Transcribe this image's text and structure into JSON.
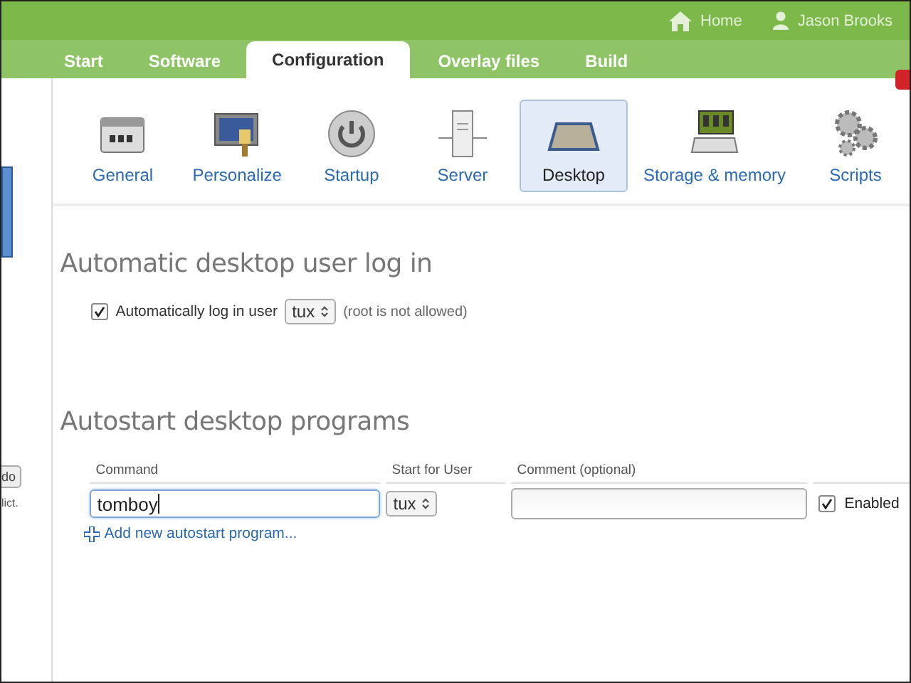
{
  "header": {
    "links": [
      {
        "label": "Home",
        "kind": "home"
      },
      {
        "label": "Jason Brooks",
        "kind": "user"
      }
    ]
  },
  "tabs": [
    {
      "label": "Start",
      "selected": false
    },
    {
      "label": "Software",
      "selected": false
    },
    {
      "label": "Configuration",
      "selected": true
    },
    {
      "label": "Overlay files",
      "selected": false
    },
    {
      "label": "Build",
      "selected": false
    }
  ],
  "categories": [
    {
      "label": "General",
      "kind": "general",
      "selected": false
    },
    {
      "label": "Personalize",
      "kind": "personalize",
      "selected": false
    },
    {
      "label": "Startup",
      "kind": "startup",
      "selected": false
    },
    {
      "label": "Server",
      "kind": "server",
      "selected": false
    },
    {
      "label": "Desktop",
      "kind": "desktop",
      "selected": true
    },
    {
      "label": "Storage & memory",
      "kind": "storage",
      "selected": false
    },
    {
      "label": "Scripts",
      "kind": "scripts",
      "selected": false
    }
  ],
  "left_edge": {
    "button": "do",
    "text": "lict."
  },
  "autologin": {
    "heading": "Automatic desktop user log in",
    "checked": true,
    "label": "Automatically log in user",
    "user": "tux",
    "note": "(root is not allowed)"
  },
  "autostart": {
    "heading": "Autostart desktop programs",
    "columns": [
      "Command",
      "Start for User",
      "Comment (optional)"
    ],
    "rows": [
      {
        "command": "tomboy",
        "user": "tux",
        "enabled": true,
        "enabled_label": "Enabled"
      }
    ],
    "add_link": "Add new autostart program..."
  }
}
